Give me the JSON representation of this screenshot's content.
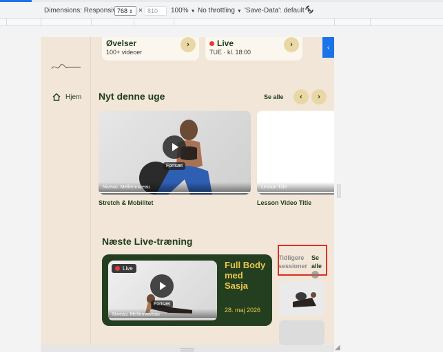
{
  "devtools": {
    "dimensions_label": "Dimensions: Responsive",
    "width_value": "768",
    "times": "×",
    "height_value": "810",
    "zoom": "100%",
    "throttling": "No throttling",
    "save_data": "'Save-Data': default"
  },
  "sidebar": {
    "logo_text": "Sasja Lunn",
    "home_label": "Hjem"
  },
  "top_cards": [
    {
      "title": "Øvelser",
      "subtitle": "100+ videoer"
    },
    {
      "title": "Live",
      "subtitle": "TUE · kl. 18:00"
    }
  ],
  "new_section": {
    "title": "Nyt denne uge",
    "see_all": "Se alle",
    "cards": [
      {
        "level": "Niveau: Mellemniveau",
        "continue": "Fortsæt",
        "caption": "Stretch & Mobilitet"
      },
      {
        "level": "Lesson Title",
        "caption": "Lesson Video Title"
      }
    ]
  },
  "live_section": {
    "title": "Næste Live-træning",
    "badge": "Live",
    "continue": "Fortsæt",
    "level": "Niveau: Mellemniveau",
    "session_title": "Full Body med Sasja",
    "date": "28. maj 2026",
    "previous_label": "Tidligere sessioner",
    "see_all": "Se alle"
  },
  "colors": {
    "page_bg": "#f1e6d8",
    "brand_green": "#243f1f",
    "accent_yellow": "#e9c74b",
    "button_beige": "#e9d8a6",
    "live_red": "#e53935"
  }
}
